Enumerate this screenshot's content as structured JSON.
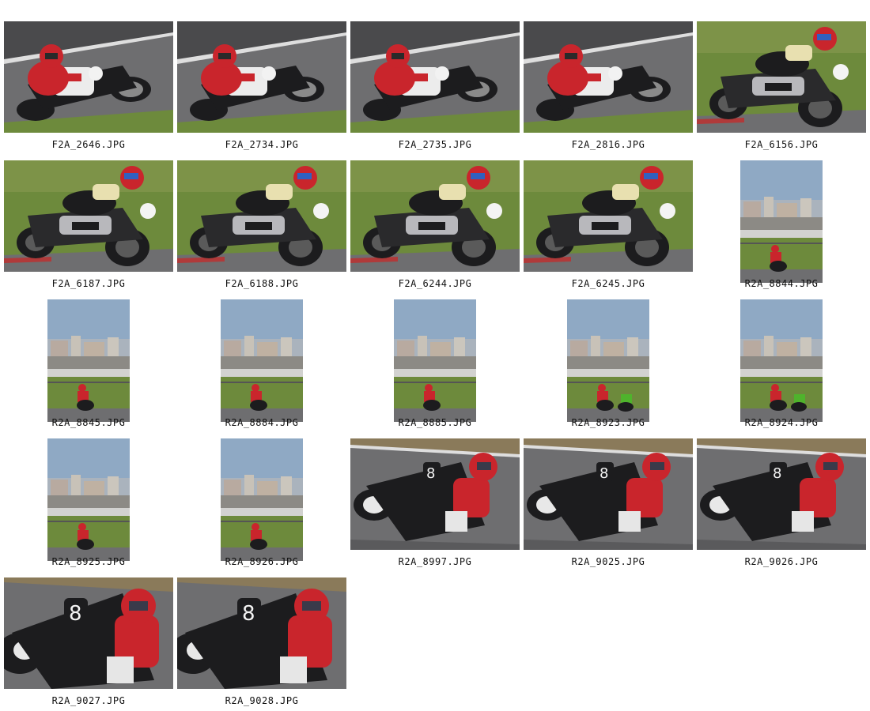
{
  "colors": {
    "track": "#6e6e70",
    "track_dark": "#4a4a4c",
    "grass": "#6d8a3c",
    "sky": "#8fa9c4",
    "buildings": "#b8aaa0",
    "rider_red": "#c9252c",
    "bike_black": "#1c1c1e",
    "tank_white": "#ececec",
    "kawasaki_green": "#4fb32c"
  },
  "photos": [
    {
      "filename": "F2A_2646.JPG",
      "orientation": "landscape",
      "scene": "track-rider-left"
    },
    {
      "filename": "F2A_2734.JPG",
      "orientation": "landscape",
      "scene": "track-rider-left"
    },
    {
      "filename": "F2A_2735.JPG",
      "orientation": "landscape",
      "scene": "track-rider-left"
    },
    {
      "filename": "F2A_2816.JPG",
      "orientation": "landscape",
      "scene": "track-rider-left"
    },
    {
      "filename": "F2A_6156.JPG",
      "orientation": "landscape",
      "scene": "grass-bike-dark"
    },
    {
      "filename": "F2A_6187.JPG",
      "orientation": "landscape",
      "scene": "grass-bike-dark"
    },
    {
      "filename": "F2A_6188.JPG",
      "orientation": "landscape",
      "scene": "grass-bike-dark"
    },
    {
      "filename": "F2A_6244.JPG",
      "orientation": "landscape",
      "scene": "grass-bike-dark"
    },
    {
      "filename": "F2A_6245.JPG",
      "orientation": "landscape",
      "scene": "grass-bike-dark"
    },
    {
      "filename": "R2A_8844.JPG",
      "orientation": "portrait",
      "scene": "city-distant"
    },
    {
      "filename": "R2A_8845.JPG",
      "orientation": "portrait",
      "scene": "city-distant"
    },
    {
      "filename": "R2A_8884.JPG",
      "orientation": "portrait",
      "scene": "city-distant"
    },
    {
      "filename": "R2A_8885.JPG",
      "orientation": "portrait",
      "scene": "city-distant"
    },
    {
      "filename": "R2A_8923.JPG",
      "orientation": "portrait",
      "scene": "city-distant-pair"
    },
    {
      "filename": "R2A_8924.JPG",
      "orientation": "portrait",
      "scene": "city-distant-pair"
    },
    {
      "filename": "R2A_8925.JPG",
      "orientation": "portrait",
      "scene": "city-distant"
    },
    {
      "filename": "R2A_8926.JPG",
      "orientation": "portrait",
      "scene": "city-distant"
    },
    {
      "filename": "R2A_8997.JPG",
      "orientation": "landscape",
      "scene": "track-rider-right"
    },
    {
      "filename": "R2A_9025.JPG",
      "orientation": "landscape",
      "scene": "track-rider-right"
    },
    {
      "filename": "R2A_9026.JPG",
      "orientation": "landscape",
      "scene": "track-rider-right"
    },
    {
      "filename": "R2A_9027.JPG",
      "orientation": "landscape",
      "scene": "closeup-rider-right"
    },
    {
      "filename": "R2A_9028.JPG",
      "orientation": "landscape",
      "scene": "closeup-rider-right"
    }
  ]
}
